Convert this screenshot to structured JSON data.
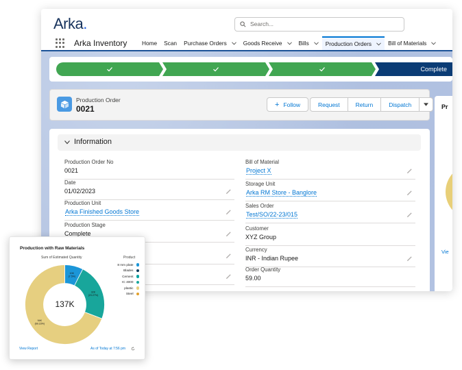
{
  "brand": {
    "logo": "Arka",
    "logo_dot": "."
  },
  "search": {
    "placeholder": "Search..."
  },
  "nav": {
    "app_name": "Arka Inventory",
    "items": [
      {
        "label": "Home",
        "dropdown": false,
        "active": false
      },
      {
        "label": "Scan",
        "dropdown": false,
        "active": false
      },
      {
        "label": "Purchase Orders",
        "dropdown": true,
        "active": false
      },
      {
        "label": "Goods Receive",
        "dropdown": true,
        "active": false
      },
      {
        "label": "Bills",
        "dropdown": true,
        "active": false
      },
      {
        "label": "Production Orders",
        "dropdown": true,
        "active": true
      },
      {
        "label": "Bill of Materials",
        "dropdown": true,
        "active": false
      }
    ]
  },
  "path": {
    "final_label": "Complete"
  },
  "record": {
    "type": "Production Order",
    "name": "0021",
    "actions": {
      "follow": "Follow",
      "request": "Request",
      "return": "Return",
      "dispatch": "Dispatch"
    }
  },
  "section": {
    "title": "Information"
  },
  "fields": {
    "left": [
      {
        "label": "Production Order No",
        "value": "0021"
      },
      {
        "label": "Date",
        "value": "01/02/2023"
      },
      {
        "label": "Production Unit",
        "value": "Arka Finished Goods Store"
      },
      {
        "label": "Production Stage",
        "value": "Complete"
      }
    ],
    "right": [
      {
        "label": "Bill of Material",
        "value": "Project X"
      },
      {
        "label": "Storage Unit",
        "value": "Arka RM Store - Banglore"
      },
      {
        "label": "Sales Order",
        "value": "Test/SO/22-23/015"
      },
      {
        "label": "Customer",
        "value": "XYZ Group"
      },
      {
        "label": "Currency",
        "value": "INR - Indian Rupee"
      },
      {
        "label": "Order Quantity",
        "value": "59.00"
      }
    ]
  },
  "side_card": {
    "title": "Pr",
    "link": "Vie"
  },
  "widget": {
    "title": "Production with Raw Materials",
    "subtitle": "Sum of Estimated Quantity",
    "legend_title": "Product",
    "center_total": "137K",
    "view_report": "View Report",
    "as_of": "As of Today at 7:56 pm"
  },
  "chart_data": {
    "type": "pie",
    "title": "Production with Raw Materials",
    "subtitle": "Sum of Estimated Quantity",
    "legend_title": "Product",
    "total_label": "137K",
    "legend": [
      {
        "name": "8 mm plate",
        "color": "#1b96d8"
      },
      {
        "name": "Blades",
        "color": "#0b3c5d"
      },
      {
        "name": "Cement",
        "color": "#0aa3a3"
      },
      {
        "name": "IC 4000",
        "color": "#18a69b"
      },
      {
        "name": "plastic",
        "color": "#e6cf80"
      },
      {
        "name": "Steel",
        "color": "#e2a02b"
      }
    ],
    "slices": [
      {
        "name": "8 mm plate",
        "label": "10K",
        "percent_label": "(7.5%)",
        "value": 7.5,
        "color": "#1b96d8"
      },
      {
        "name": "IC 4000",
        "label": "32K",
        "percent_label": "(23.27%)",
        "value": 23.27,
        "color": "#18a69b"
      },
      {
        "name": "plastic",
        "label": "94K",
        "percent_label": "(69.23%)",
        "value": 69.23,
        "color": "#e6cf80"
      }
    ]
  },
  "colors": {
    "complete_step": "#41a652",
    "current_step": "#0b3c75",
    "link": "#0176d3",
    "record_icon": "#4a9ae3"
  }
}
